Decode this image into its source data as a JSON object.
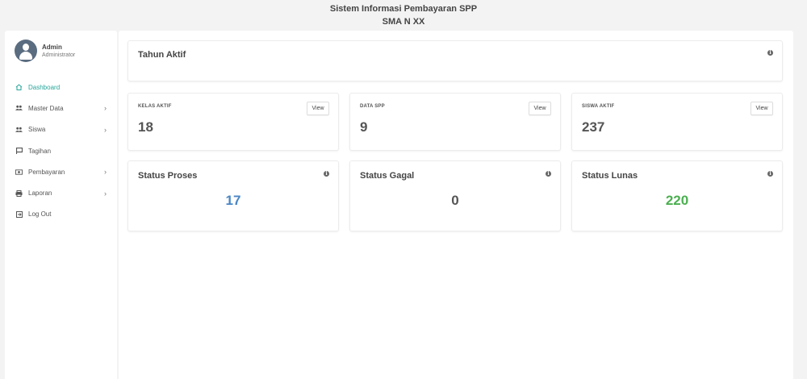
{
  "header": {
    "title": "Sistem Informasi Pembayaran SPP",
    "subtitle": "SMA N XX"
  },
  "user": {
    "name": "Admin",
    "role": "Administrator",
    "icon": "user-avatar-icon"
  },
  "sidebar": {
    "items": [
      {
        "label": "Dashboard",
        "icon": "home-icon",
        "active": true,
        "has_submenu": false
      },
      {
        "label": "Master Data",
        "icon": "users-icon",
        "active": false,
        "has_submenu": true
      },
      {
        "label": "Siswa",
        "icon": "users-icon",
        "active": false,
        "has_submenu": true
      },
      {
        "label": "Tagihan",
        "icon": "flag-icon",
        "active": false,
        "has_submenu": false
      },
      {
        "label": "Pembayaran",
        "icon": "money-icon",
        "active": false,
        "has_submenu": true
      },
      {
        "label": "Laporan",
        "icon": "print-icon",
        "active": false,
        "has_submenu": true
      },
      {
        "label": "Log Out",
        "icon": "logout-icon",
        "active": false,
        "has_submenu": false
      }
    ]
  },
  "tahun_aktif": {
    "title": "Tahun Aktif"
  },
  "stats": [
    {
      "label": "KELAS AKTIF",
      "value": "18",
      "button": "View"
    },
    {
      "label": "DATA SPP",
      "value": "9",
      "button": "View"
    },
    {
      "label": "SISWA AKTIF",
      "value": "237",
      "button": "View"
    }
  ],
  "status": [
    {
      "title": "Status Proses",
      "value": "17",
      "color": "#4a86c5"
    },
    {
      "title": "Status Gagal",
      "value": "0",
      "color": "#555555"
    },
    {
      "title": "Status Lunas",
      "value": "220",
      "color": "#4caf50"
    }
  ],
  "colors": {
    "accent": "#26a69a",
    "background": "#f3f3f3"
  }
}
